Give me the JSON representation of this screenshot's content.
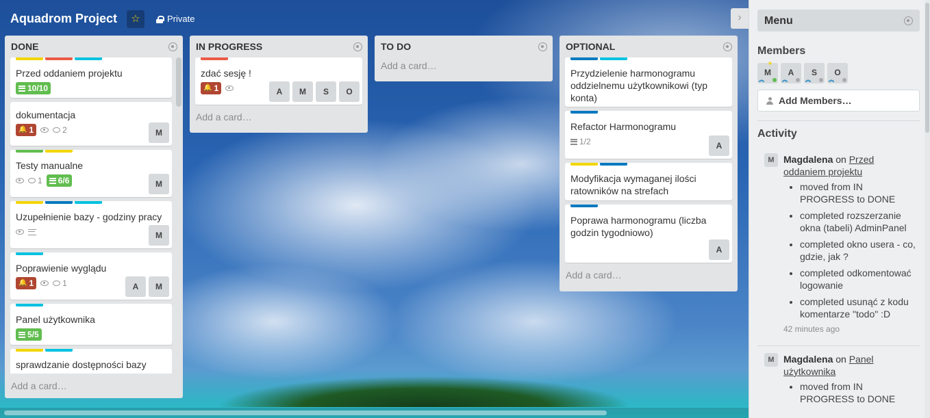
{
  "board": {
    "title": "Aquadrom Project",
    "visibility": "Private"
  },
  "colors": {
    "yellow": "#f2d600",
    "red": "#eb5a46",
    "cyan": "#00c2e0",
    "green": "#61bd4f",
    "blue": "#0079bf",
    "due_red": "#b04632"
  },
  "lists": [
    {
      "title": "DONE",
      "add_card": "Add a card…",
      "cards": [
        {
          "labels": [
            "yellow",
            "red",
            "cyan"
          ],
          "title": "Przed oddaniem projektu",
          "checklist": "10/10",
          "members": []
        },
        {
          "labels": [],
          "title": "dokumentacja",
          "due": "1",
          "watch": true,
          "comments": "2",
          "members": [
            "M"
          ]
        },
        {
          "labels": [
            "green",
            "yellow"
          ],
          "title": "Testy manualne",
          "watch": true,
          "comments": "1",
          "checklist": "6/6",
          "members": [
            "M"
          ]
        },
        {
          "labels": [
            "yellow",
            "blue",
            "cyan"
          ],
          "title": "Uzupełnienie bazy - godziny pracy",
          "watch": true,
          "description": true,
          "members": [
            "M"
          ]
        },
        {
          "labels": [
            "cyan"
          ],
          "title": "Poprawienie wyglądu",
          "due": "1",
          "watch": true,
          "comments": "1",
          "members": [
            "A",
            "M"
          ]
        },
        {
          "labels": [
            "cyan"
          ],
          "title": "Panel użytkownika",
          "checklist": "5/5",
          "members": []
        },
        {
          "labels": [
            "yellow",
            "cyan"
          ],
          "title": "sprawdzanie dostępności bazy przy logowaniu",
          "members": []
        }
      ]
    },
    {
      "title": "IN PROGRESS",
      "add_card": "Add a card…",
      "cards": [
        {
          "labels": [
            "red"
          ],
          "title": "zdać sesję !",
          "due": "1",
          "watch": true,
          "members": [
            "A",
            "M",
            "S",
            "O"
          ]
        }
      ]
    },
    {
      "title": "TO DO",
      "add_card": "Add a card…",
      "cards": []
    },
    {
      "title": "OPTIONAL",
      "add_card": "Add a card…",
      "cards": [
        {
          "labels": [
            "blue",
            "cyan"
          ],
          "title": "Przydzielenie harmonogramu oddzielnemu użytkownikowi (typ konta)",
          "members": []
        },
        {
          "labels": [
            "blue"
          ],
          "title": "Refactor Harmonogramu",
          "checklist_plain": "1/2",
          "members": [
            "A"
          ]
        },
        {
          "labels": [
            "yellow",
            "blue"
          ],
          "title": "Modyfikacja wymaganej ilości ratowników na strefach",
          "members": []
        },
        {
          "labels": [
            "blue"
          ],
          "title": "Poprawa harmonogramu (liczba godzin tygodniowo)",
          "members": [
            "A"
          ]
        }
      ]
    }
  ],
  "sidebar": {
    "menu_title": "Menu",
    "members_title": "Members",
    "members": [
      "M",
      "A",
      "S",
      "O"
    ],
    "add_members": "Add Members…",
    "activity_title": "Activity",
    "activity": [
      {
        "avatar": "M",
        "user": "Magdalena",
        "on": "on",
        "card": "Przed oddaniem projektu",
        "items": [
          "moved from IN PROGRESS to DONE",
          "completed rozszerzanie okna (tabeli) AdminPanel",
          "completed okno usera - co, gdzie, jak ?",
          "completed odkomentować logowanie",
          "completed usunąć z kodu komentarze \"todo\" :D"
        ],
        "time": "42 minutes ago"
      },
      {
        "avatar": "M",
        "user": "Magdalena",
        "on": "on",
        "card": "Panel użytkownika",
        "items": [
          "moved from IN PROGRESS to DONE"
        ],
        "time": ""
      }
    ]
  }
}
